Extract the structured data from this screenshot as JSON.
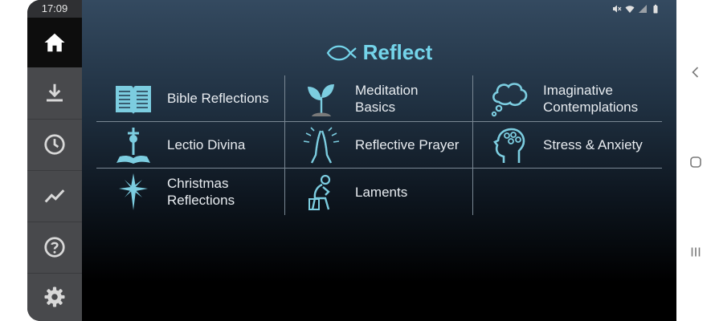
{
  "status_bar": {
    "time": "17:09",
    "icons": [
      "mute-icon",
      "wifi-icon",
      "signal-icon",
      "battery-icon"
    ]
  },
  "sidebar": {
    "items": [
      {
        "icon": "home-icon",
        "active": true
      },
      {
        "icon": "download-icon",
        "active": false
      },
      {
        "icon": "history-clock-icon",
        "active": false
      },
      {
        "icon": "stats-trend-icon",
        "active": false
      },
      {
        "icon": "help-icon",
        "active": false
      },
      {
        "icon": "settings-gear-icon",
        "active": false
      }
    ]
  },
  "header": {
    "title": "Reflect",
    "icon": "fish-icon"
  },
  "categories": [
    {
      "label": "Bible Reflections",
      "icon": "open-bible-icon"
    },
    {
      "label": "Meditation\nBasics",
      "icon": "sprout-icon"
    },
    {
      "label": "Imaginative\nContemplations",
      "icon": "thought-bubble-icon"
    },
    {
      "label": "Lectio Divina",
      "icon": "bible-cross-icon"
    },
    {
      "label": "Reflective Prayer",
      "icon": "praying-hands-icon"
    },
    {
      "label": "Stress & Anxiety",
      "icon": "head-stress-icon"
    },
    {
      "label": "Christmas\nReflections",
      "icon": "star-icon"
    },
    {
      "label": "Laments",
      "icon": "lament-figure-icon"
    }
  ],
  "android_nav": {
    "buttons": [
      "back-icon",
      "home-circle-icon",
      "recents-icon"
    ]
  },
  "colors": {
    "accent": "#74d4ea",
    "sidebar": "#48494c",
    "text": "#e8ecf0"
  }
}
